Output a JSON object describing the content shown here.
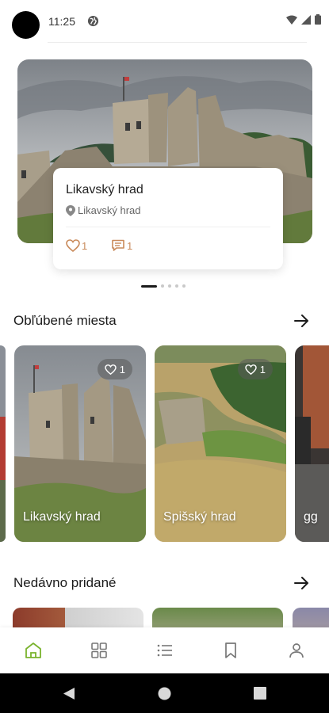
{
  "status": {
    "time": "11:25"
  },
  "hero": {
    "title": "Likavský hrad",
    "location": "Likavský hrad",
    "likes": "1",
    "comments": "1",
    "page_count": 5,
    "active_page": 1
  },
  "favorites": {
    "title": "Obľúbené miesta",
    "items": [
      {
        "label": "Likavský hrad",
        "likes": "1"
      },
      {
        "label": "Spišský hrad",
        "likes": "1"
      },
      {
        "label": "gg"
      }
    ]
  },
  "recent": {
    "title": "Nedávno pridané"
  },
  "bottom_nav": {
    "items": [
      "home",
      "categories",
      "list",
      "bookmarks",
      "profile"
    ],
    "active": "home",
    "active_color": "#7ab32e"
  },
  "colors": {
    "accent": "#7ab32e",
    "like": "#c98a5a"
  }
}
